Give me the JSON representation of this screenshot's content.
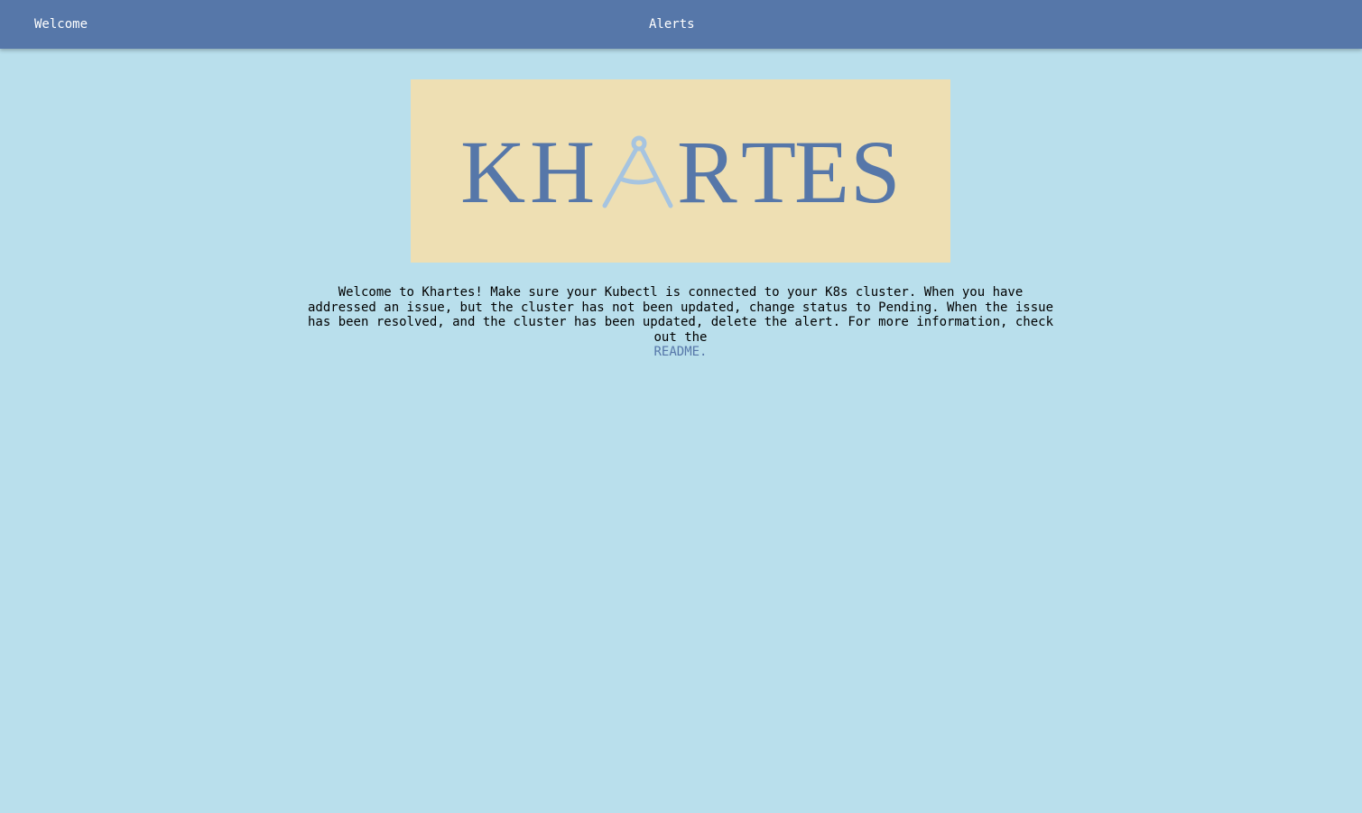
{
  "navbar": {
    "welcome_label": "Welcome",
    "alerts_label": "Alerts"
  },
  "logo": {
    "text": "KHARTES",
    "icon": "compass-icon",
    "colors": {
      "banner_bg": "#eedfb3",
      "letters": "#5677a9",
      "compass": "#a6c4e0"
    }
  },
  "intro": {
    "text": "Welcome to Khartes! Make sure your Kubectl is connected to your K8s cluster. When you have addressed an issue, but the cluster has not been updated, change status to Pending. When the issue has been resolved, and the cluster has been updated, delete the alert. For more information, check out the",
    "link_label": "README."
  },
  "colors": {
    "navbar": "#5677a9",
    "page_bg": "#b9dfec",
    "link": "#5677a9"
  }
}
